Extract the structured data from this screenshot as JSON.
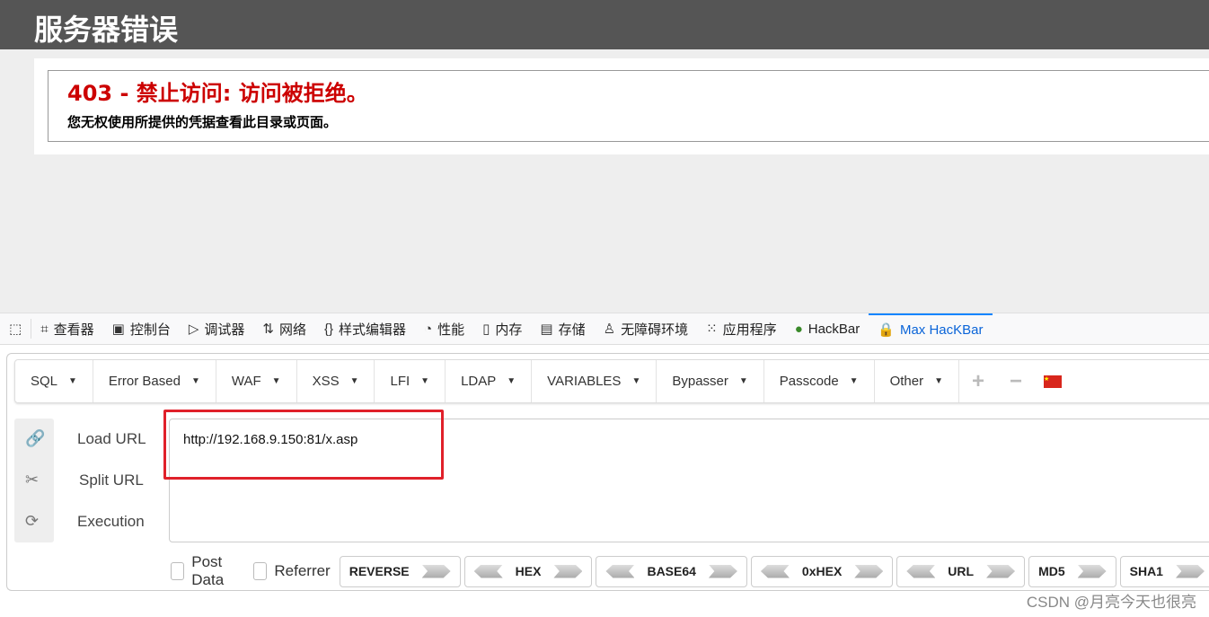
{
  "page": {
    "title": "服务器错误",
    "error_heading": "403 - 禁止访问: 访问被拒绝。",
    "error_message": "您无权使用所提供的凭据查看此目录或页面。"
  },
  "devtools": {
    "tabs": [
      {
        "label": "查看器",
        "icon": "inspector-icon"
      },
      {
        "label": "控制台",
        "icon": "console-icon"
      },
      {
        "label": "调试器",
        "icon": "debugger-icon"
      },
      {
        "label": "网络",
        "icon": "network-icon"
      },
      {
        "label": "样式编辑器",
        "icon": "style-editor-icon"
      },
      {
        "label": "性能",
        "icon": "performance-icon"
      },
      {
        "label": "内存",
        "icon": "memory-icon"
      },
      {
        "label": "存储",
        "icon": "storage-icon"
      },
      {
        "label": "无障碍环境",
        "icon": "accessibility-icon"
      },
      {
        "label": "应用程序",
        "icon": "application-icon"
      },
      {
        "label": "HackBar",
        "icon": "hackbar-icon"
      },
      {
        "label": "Max HacKBar",
        "icon": "lock-icon",
        "active": true
      }
    ],
    "accent": "#0a64d8"
  },
  "hackbar": {
    "menu": [
      "SQL",
      "Error Based",
      "WAF",
      "XSS",
      "LFI",
      "LDAP",
      "VARIABLES",
      "Bypasser",
      "Passcode",
      "Other"
    ],
    "actions": {
      "load": "Load URL",
      "split": "Split URL",
      "execute": "Execution"
    },
    "url": "http://192.168.9.150:81/x.asp",
    "checkboxes": {
      "post": "Post Data",
      "referrer": "Referrer"
    },
    "encoders": [
      "REVERSE",
      "HEX",
      "BASE64",
      "0xHEX",
      "URL",
      "MD5",
      "SHA1"
    ]
  },
  "watermark": "CSDN @月亮今天也很亮"
}
